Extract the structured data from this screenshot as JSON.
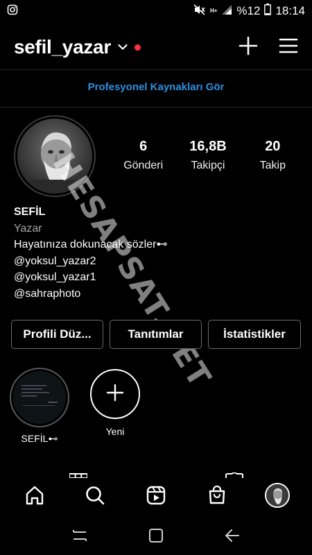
{
  "status_bar": {
    "battery_percent": "%12",
    "time": "18:14",
    "network": "H+"
  },
  "header": {
    "username": "sefil_yazar",
    "has_notification_dot": true,
    "notification_dot_color": "#ff3040"
  },
  "professional_link": "Profesyonel Kaynakları Gör",
  "stats": [
    {
      "value": "6",
      "label": "Gönderi"
    },
    {
      "value": "16,8B",
      "label": "Takipçi"
    },
    {
      "value": "20",
      "label": "Takip"
    }
  ],
  "bio": {
    "name": "SEFİL",
    "category": "Yazar",
    "lines": [
      "Hayatınıza dokunacak sözler⊷",
      "@yoksul_yazar2",
      "@yoksul_yazar1",
      "@sahraphoto"
    ]
  },
  "watermark": "HESAPSAT.NET",
  "buttons": {
    "edit_profile": "Profili Düz...",
    "promotions": "Tanıtımlar",
    "insights": "İstatistikler"
  },
  "highlights": [
    {
      "label": "SEFİL⊷"
    },
    {
      "label": "Yeni"
    }
  ],
  "nav_icons": [
    "home-icon",
    "search-icon",
    "reels-icon",
    "shop-icon",
    "profile-avatar"
  ],
  "colors": {
    "link_blue": "#2f8fe0",
    "background": "#000000"
  }
}
